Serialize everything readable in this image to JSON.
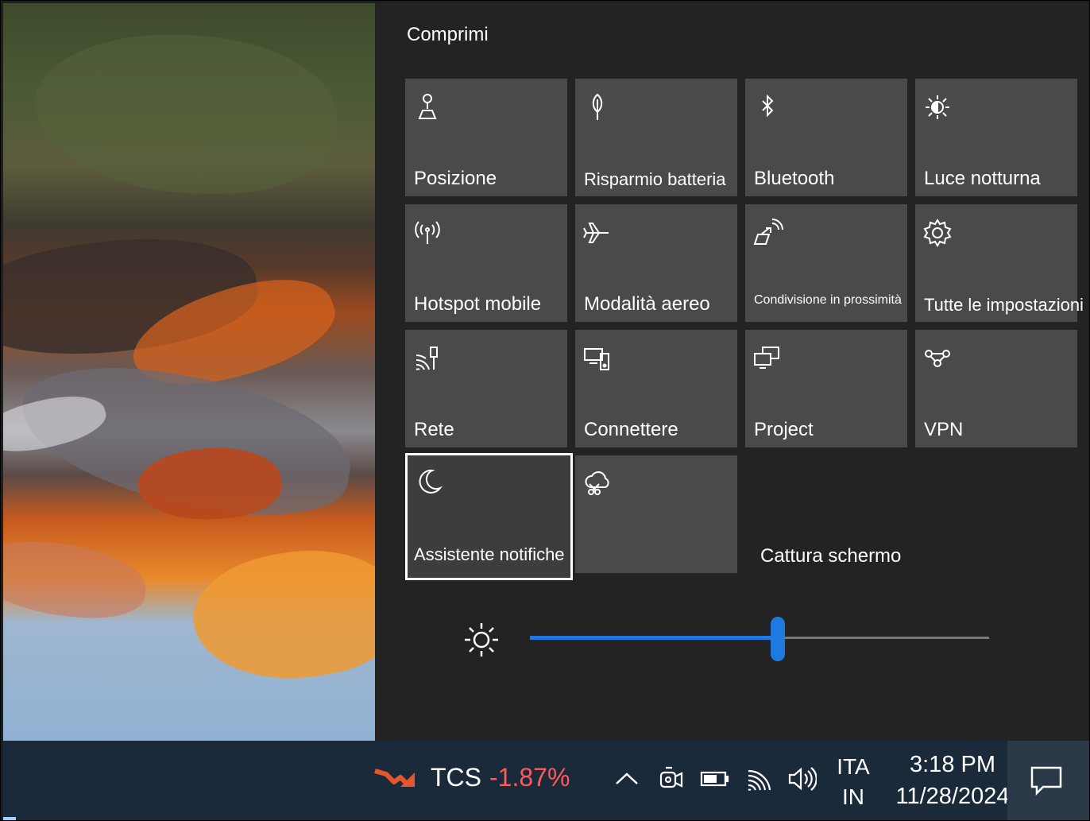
{
  "action_center": {
    "collapse_label": "Comprimi",
    "tiles": [
      {
        "label": "Posizione",
        "icon": "location-icon"
      },
      {
        "label": "Risparmio batteria",
        "icon": "battery-saver-icon"
      },
      {
        "label": "Bluetooth",
        "icon": "bluetooth-icon"
      },
      {
        "label": "Luce notturna",
        "icon": "night-light-icon"
      },
      {
        "label": "Hotspot mobile",
        "icon": "mobile-hotspot-icon"
      },
      {
        "label": "Modalità aereo",
        "icon": "airplane-icon"
      },
      {
        "label": "Condivisione in prossimità",
        "icon": "nearby-sharing-icon"
      },
      {
        "label": "Tutte le impostazioni",
        "icon": "gear-icon"
      },
      {
        "label": "Rete",
        "icon": "network-icon"
      },
      {
        "label": "Connettere",
        "icon": "connect-icon"
      },
      {
        "label": "Project",
        "icon": "project-icon"
      },
      {
        "label": "VPN",
        "icon": "vpn-icon"
      },
      {
        "label": "Assistente notifiche",
        "icon": "moon-icon",
        "focused": true
      },
      {
        "label": "",
        "icon": "screen-snip-icon"
      }
    ],
    "capture_label": "Cattura schermo",
    "brightness": {
      "icon": "brightness-icon",
      "level_percent": 54
    },
    "accent_color": "#1f7ae0"
  },
  "taskbar": {
    "stock": {
      "icon": "stock-down-icon",
      "ticker": "TCS",
      "change": "-1.87%",
      "change_color": "#ff5a5a"
    },
    "tray_icons": [
      "chevron-up-icon",
      "meet-now-icon",
      "battery-icon",
      "wifi-icon",
      "volume-icon"
    ],
    "language": {
      "line1": "ITA",
      "line2": "IN"
    },
    "clock": {
      "time": "3:18 PM",
      "date": "11/28/2024"
    },
    "notification_icon": "notification-icon"
  }
}
